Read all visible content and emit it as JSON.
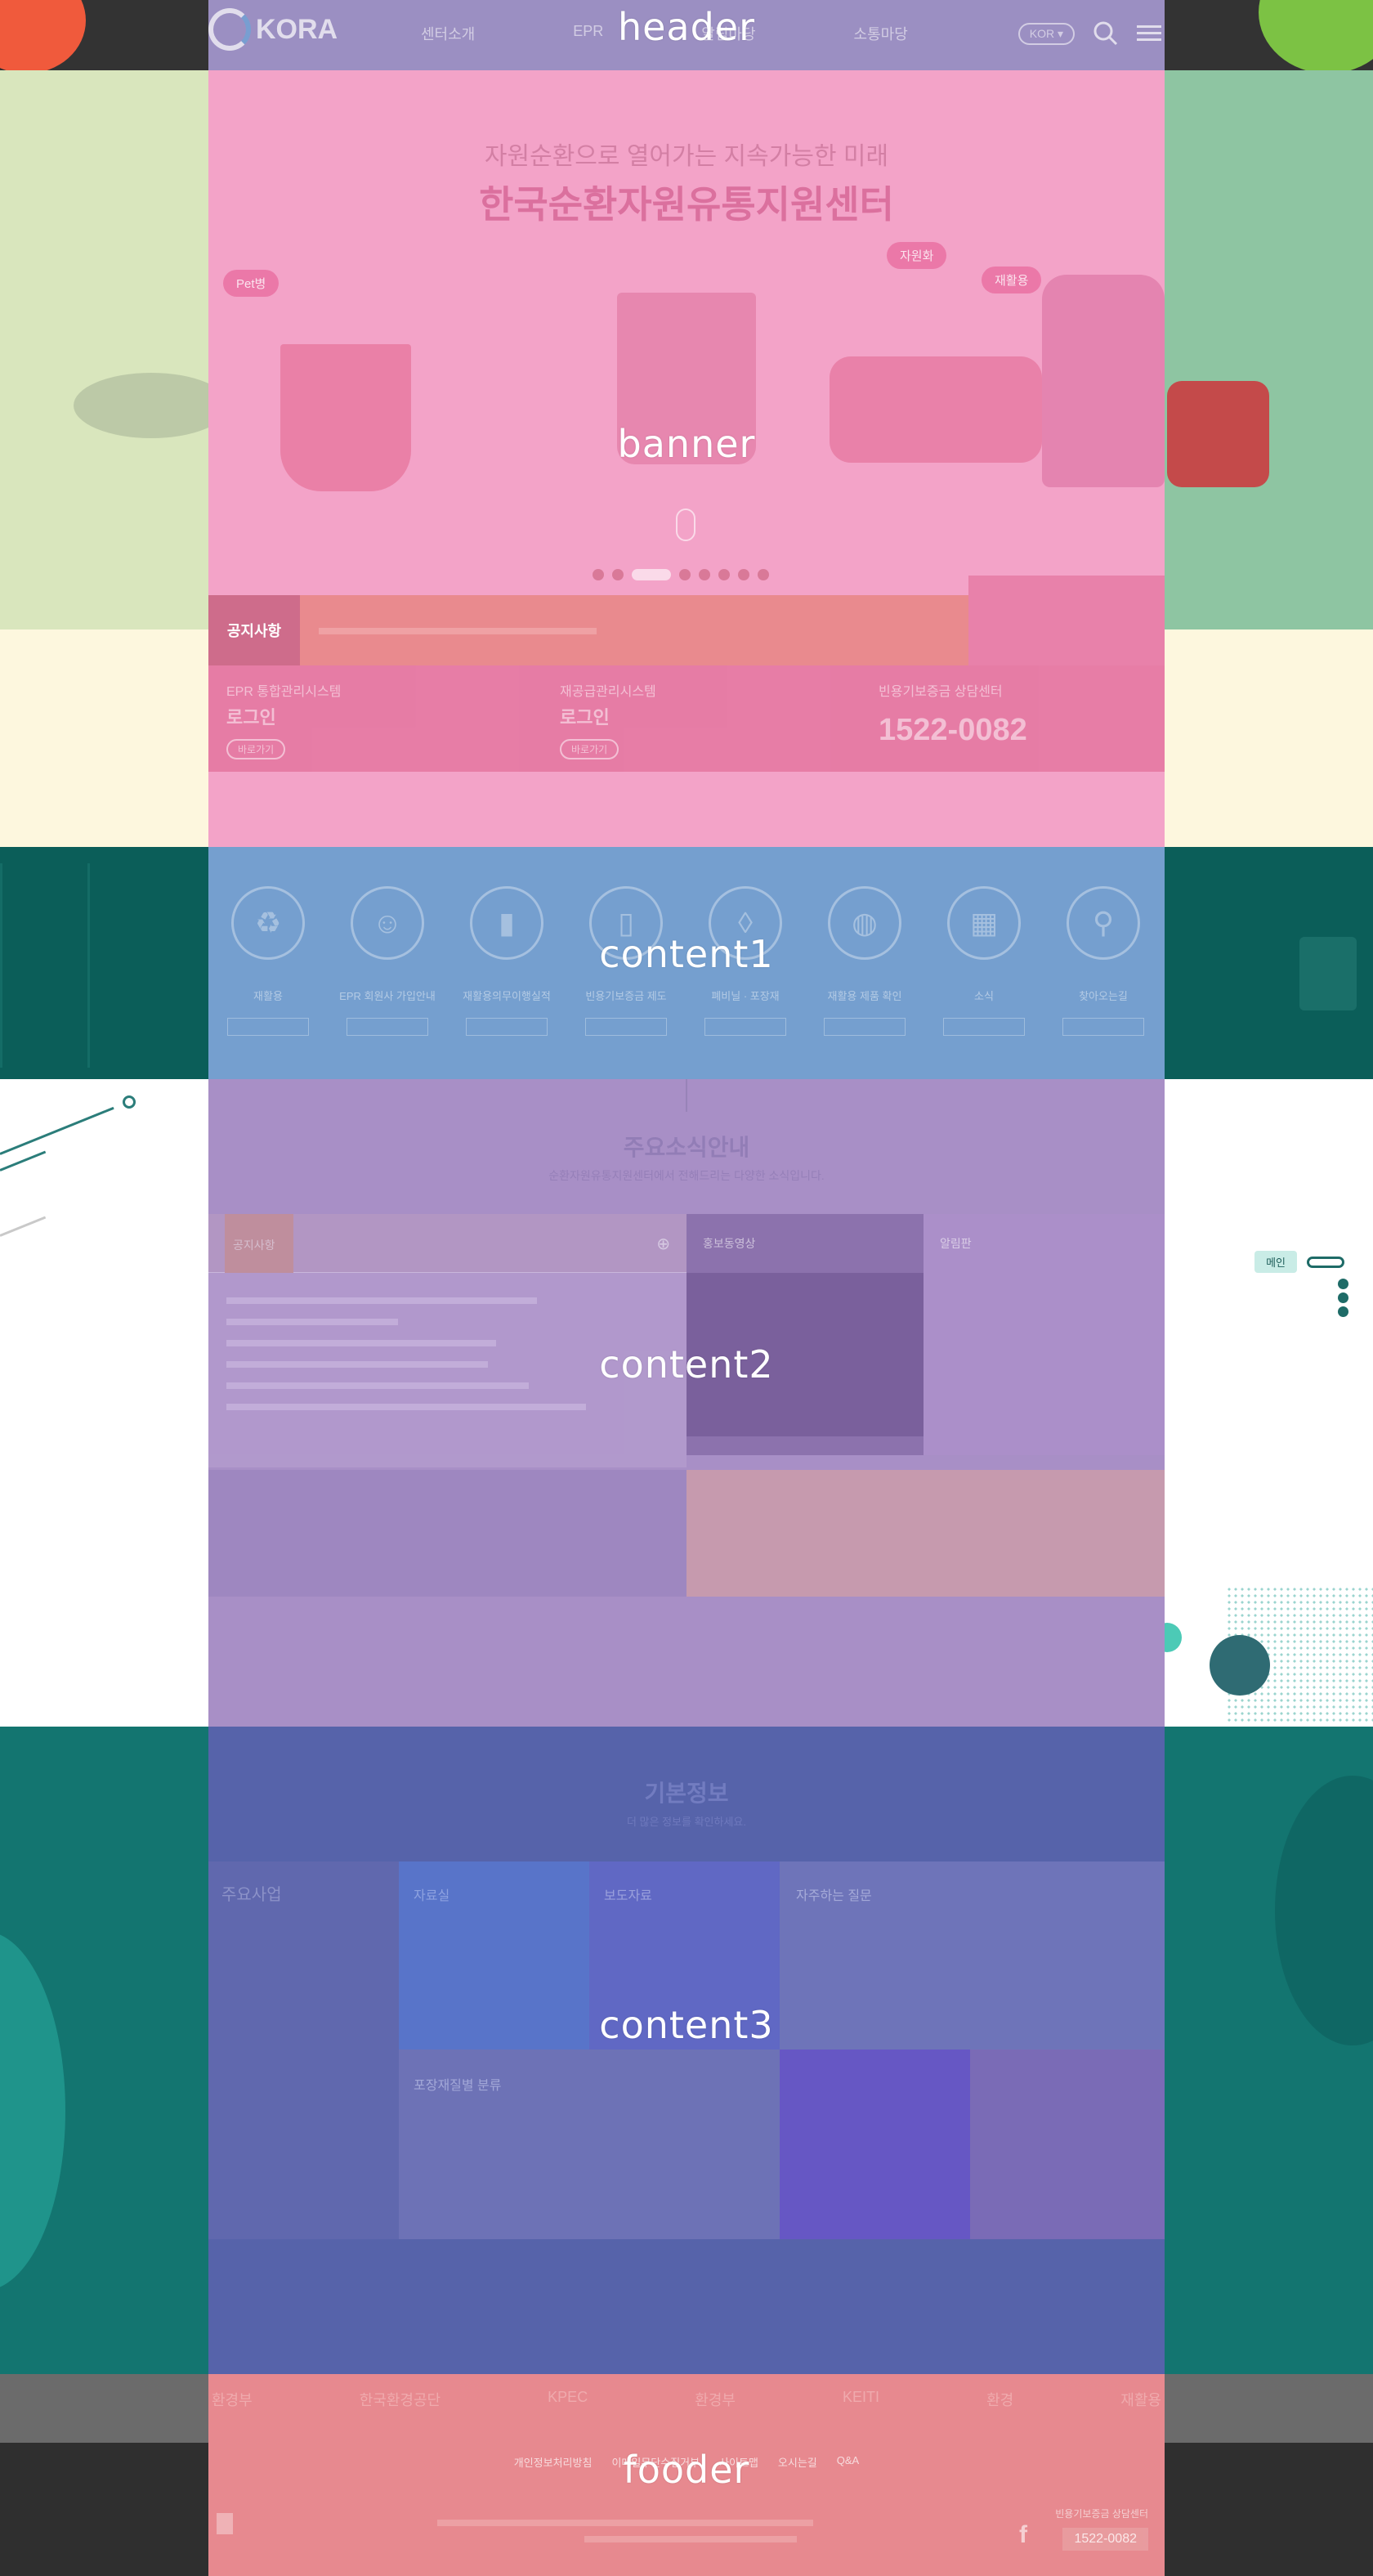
{
  "sections": {
    "header": "header",
    "banner": "banner",
    "content1": "content1",
    "content2": "content2",
    "content3": "content3",
    "footer": "fooder"
  },
  "header": {
    "logo_text": "KORA",
    "nav": [
      "센터소개",
      "EPR",
      "알림마당",
      "소통마당"
    ],
    "lang_label": "KOR",
    "icons": [
      "search-icon",
      "menu-icon"
    ]
  },
  "banner": {
    "headline": "자원순환으로 열어가는 지속가능한 미래",
    "title": "한국순환자원유통지원센터",
    "tags": [
      "Pet병",
      "자원화",
      "재활용"
    ],
    "notice_label": "공지사항",
    "login_cards": [
      {
        "title": "EPR 통합관리시스템",
        "main": "로그인",
        "btn": "바로가기"
      },
      {
        "title": "재공급관리시스템",
        "main": "로그인",
        "btn": "바로가기"
      }
    ],
    "call_center_label": "빈용기보증금 상담센터",
    "phone": "1522-0082"
  },
  "content1": {
    "quick_items": [
      "재활용",
      "EPR 회원사 가입안내",
      "재활용의무이행실적",
      "빈용기보증금 제도",
      "폐비닐 · 포장재",
      "재활용 제품 확인",
      "소식",
      "찾아오는길"
    ]
  },
  "content2": {
    "title": "주요소식안내",
    "desc": "순환자원유통지원센터에서 전해드리는 다양한 소식입니다.",
    "tabs": [
      "공지사항",
      "홍보동영상",
      "알림판"
    ],
    "side_chip": "메인"
  },
  "content3": {
    "title": "기본정보",
    "desc": "더 많은 정보를 확인하세요.",
    "boxes": [
      "주요사업",
      "자료실",
      "보도자료",
      "포장재질별 분류",
      "자주하는 질문"
    ]
  },
  "footer": {
    "partners": [
      "환경부",
      "한국환경공단",
      "KPEC",
      "환경부",
      "KEITI",
      "환경",
      "재활용"
    ],
    "links": [
      "개인정보처리방침",
      "이메일무단수집거부",
      "사이트맵",
      "오시는길",
      "Q&A"
    ],
    "phone_label": "빈용기보증금 상담센터",
    "phone": "1522-0082"
  },
  "colors": {
    "header_overlay": "#9b8fc2",
    "banner_overlay": "#f3a3c8",
    "content1_overlay": "#759fcf",
    "content2_overlay": "#a88fc6",
    "content3_overlay": "#5663aa",
    "footer_overlay": "#e7898f"
  }
}
